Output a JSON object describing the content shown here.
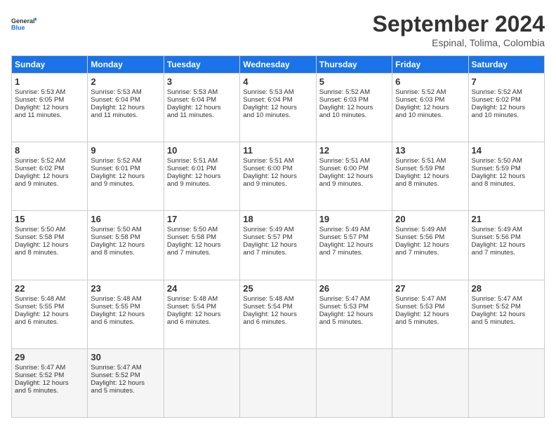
{
  "logo": {
    "line1": "General",
    "line2": "Blue"
  },
  "title": "September 2024",
  "subtitle": "Espinal, Tolima, Colombia",
  "headers": [
    "Sunday",
    "Monday",
    "Tuesday",
    "Wednesday",
    "Thursday",
    "Friday",
    "Saturday"
  ],
  "weeks": [
    [
      {
        "day": 1,
        "rise": "5:53 AM",
        "set": "6:05 PM",
        "daylight": "12 hours and 11 minutes."
      },
      {
        "day": 2,
        "rise": "5:53 AM",
        "set": "6:04 PM",
        "daylight": "12 hours and 11 minutes."
      },
      {
        "day": 3,
        "rise": "5:53 AM",
        "set": "6:04 PM",
        "daylight": "12 hours and 11 minutes."
      },
      {
        "day": 4,
        "rise": "5:53 AM",
        "set": "6:04 PM",
        "daylight": "12 hours and 10 minutes."
      },
      {
        "day": 5,
        "rise": "5:52 AM",
        "set": "6:03 PM",
        "daylight": "12 hours and 10 minutes."
      },
      {
        "day": 6,
        "rise": "5:52 AM",
        "set": "6:03 PM",
        "daylight": "12 hours and 10 minutes."
      },
      {
        "day": 7,
        "rise": "5:52 AM",
        "set": "6:02 PM",
        "daylight": "12 hours and 10 minutes."
      }
    ],
    [
      {
        "day": 8,
        "rise": "5:52 AM",
        "set": "6:02 PM",
        "daylight": "12 hours and 9 minutes."
      },
      {
        "day": 9,
        "rise": "5:52 AM",
        "set": "6:01 PM",
        "daylight": "12 hours and 9 minutes."
      },
      {
        "day": 10,
        "rise": "5:51 AM",
        "set": "6:01 PM",
        "daylight": "12 hours and 9 minutes."
      },
      {
        "day": 11,
        "rise": "5:51 AM",
        "set": "6:00 PM",
        "daylight": "12 hours and 9 minutes."
      },
      {
        "day": 12,
        "rise": "5:51 AM",
        "set": "6:00 PM",
        "daylight": "12 hours and 9 minutes."
      },
      {
        "day": 13,
        "rise": "5:51 AM",
        "set": "5:59 PM",
        "daylight": "12 hours and 8 minutes."
      },
      {
        "day": 14,
        "rise": "5:50 AM",
        "set": "5:59 PM",
        "daylight": "12 hours and 8 minutes."
      }
    ],
    [
      {
        "day": 15,
        "rise": "5:50 AM",
        "set": "5:58 PM",
        "daylight": "12 hours and 8 minutes."
      },
      {
        "day": 16,
        "rise": "5:50 AM",
        "set": "5:58 PM",
        "daylight": "12 hours and 8 minutes."
      },
      {
        "day": 17,
        "rise": "5:50 AM",
        "set": "5:58 PM",
        "daylight": "12 hours and 7 minutes."
      },
      {
        "day": 18,
        "rise": "5:49 AM",
        "set": "5:57 PM",
        "daylight": "12 hours and 7 minutes."
      },
      {
        "day": 19,
        "rise": "5:49 AM",
        "set": "5:57 PM",
        "daylight": "12 hours and 7 minutes."
      },
      {
        "day": 20,
        "rise": "5:49 AM",
        "set": "5:56 PM",
        "daylight": "12 hours and 7 minutes."
      },
      {
        "day": 21,
        "rise": "5:49 AM",
        "set": "5:56 PM",
        "daylight": "12 hours and 7 minutes."
      }
    ],
    [
      {
        "day": 22,
        "rise": "5:48 AM",
        "set": "5:55 PM",
        "daylight": "12 hours and 6 minutes."
      },
      {
        "day": 23,
        "rise": "5:48 AM",
        "set": "5:55 PM",
        "daylight": "12 hours and 6 minutes."
      },
      {
        "day": 24,
        "rise": "5:48 AM",
        "set": "5:54 PM",
        "daylight": "12 hours and 6 minutes."
      },
      {
        "day": 25,
        "rise": "5:48 AM",
        "set": "5:54 PM",
        "daylight": "12 hours and 6 minutes."
      },
      {
        "day": 26,
        "rise": "5:47 AM",
        "set": "5:53 PM",
        "daylight": "12 hours and 5 minutes."
      },
      {
        "day": 27,
        "rise": "5:47 AM",
        "set": "5:53 PM",
        "daylight": "12 hours and 5 minutes."
      },
      {
        "day": 28,
        "rise": "5:47 AM",
        "set": "5:52 PM",
        "daylight": "12 hours and 5 minutes."
      }
    ],
    [
      {
        "day": 29,
        "rise": "5:47 AM",
        "set": "5:52 PM",
        "daylight": "12 hours and 5 minutes."
      },
      {
        "day": 30,
        "rise": "5:47 AM",
        "set": "5:52 PM",
        "daylight": "12 hours and 5 minutes."
      },
      null,
      null,
      null,
      null,
      null
    ]
  ]
}
